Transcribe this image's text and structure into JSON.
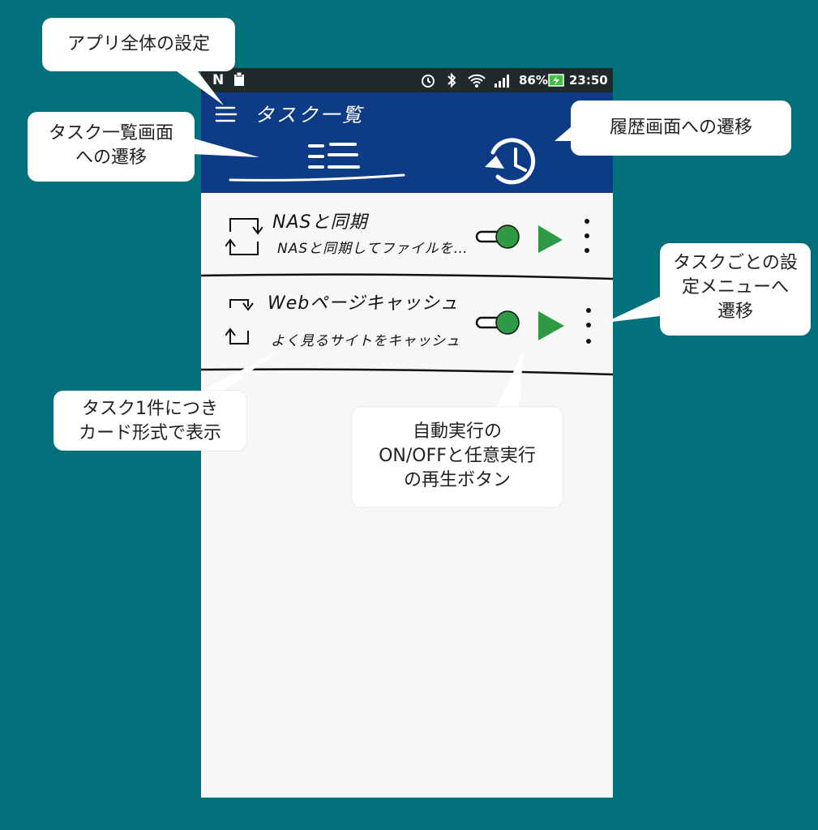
{
  "status_bar": {
    "battery": "86%",
    "time": "23:50"
  },
  "app_bar": {
    "title": "タスク一覧"
  },
  "tasks": [
    {
      "title": "NASと同期",
      "description": "NASと同期してファイルを…"
    },
    {
      "title": "Webページキャッシュ",
      "description": "よく見るサイトをキャッシュ"
    }
  ],
  "annotations": {
    "app_settings": "アプリ全体の設定",
    "task_list_nav": [
      "タスク一覧画面",
      "への遷移"
    ],
    "history_nav": "履歴画面への遷移",
    "task_menu": [
      "タスクごとの設",
      "定メニューへ",
      "遷移"
    ],
    "card_format": [
      "タスク1件につき",
      "カード形式で表示"
    ],
    "auto_run": [
      "自動実行の",
      "ON/OFFと任意実行",
      "の再生ボタン"
    ]
  },
  "colors": {
    "background": "#02717c",
    "app_bar": "#0e3b86",
    "status_bar": "#202a2a",
    "accent_green": "#2f9a45"
  },
  "icons": [
    "menu-icon",
    "list-icon",
    "history-icon",
    "sync-icon",
    "toggle-icon",
    "play-icon",
    "more-vert-icon",
    "alarm-icon",
    "bluetooth-icon",
    "wifi-icon",
    "signal-icon",
    "battery-icon"
  ]
}
